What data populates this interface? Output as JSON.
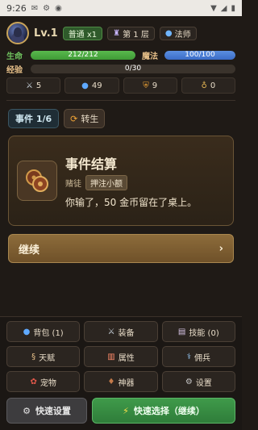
{
  "status_bar": {
    "time": "9:26"
  },
  "player": {
    "level": "Lv.1",
    "difficulty": "普通 x1",
    "floor": "第 1 层",
    "class": "法师"
  },
  "bars": {
    "hp_label": "生命",
    "hp_text": "212/212",
    "hp_fraction": 1.0,
    "mp_label": "魔法",
    "mp_text": "100/100",
    "mp_fraction": 1.0,
    "xp_label": "经验",
    "xp_text": "0/30",
    "xp_fraction": 0.0
  },
  "stats": {
    "attack": "5",
    "defense_mp": "49",
    "shield": "9",
    "gold": "0"
  },
  "event": {
    "counter": "事件 1/6",
    "turn_label": "转生"
  },
  "card": {
    "title": "事件结算",
    "npc": "赌徒",
    "action": "押注小额",
    "desc": "你输了，50 金币留在了桌上。"
  },
  "continue_label": "继续",
  "menu": {
    "bag": "背包 (1)",
    "equip": "装备",
    "skills": "技能 (0)",
    "talent": "天赋",
    "attributes": "属性",
    "mercenary": "佣兵",
    "pet": "宠物",
    "artifact": "神器",
    "settings": "设置"
  },
  "actions": {
    "quick_settings": "快速设置",
    "quick_select": "快速选择（继续）"
  },
  "colors": {
    "hp": "#4fae43",
    "mp": "#4a7ed6",
    "continue": "#7d5d31",
    "quick_select": "#37904a"
  }
}
